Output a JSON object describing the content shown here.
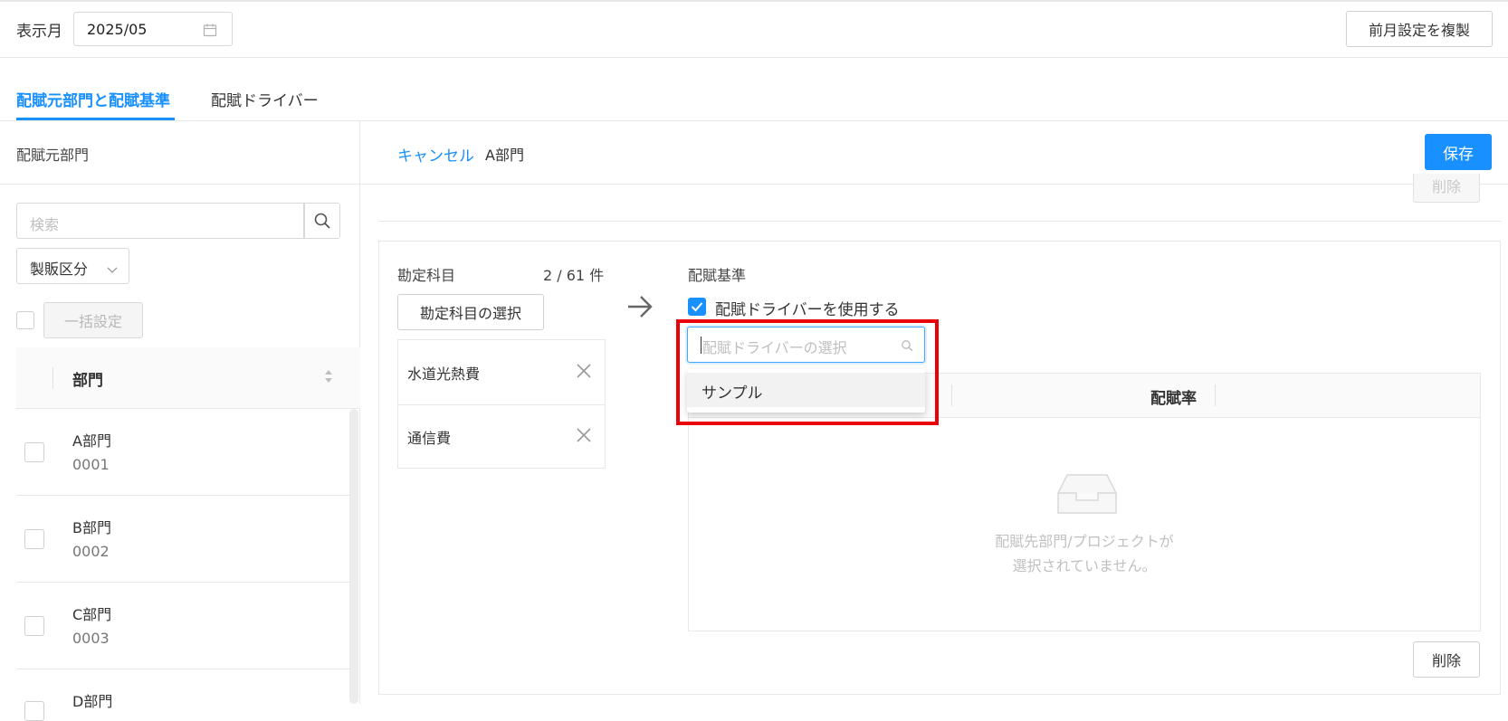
{
  "header": {
    "month_label": "表示月",
    "month_value": "2025/05",
    "copy_button": "前月設定を複製"
  },
  "tabs": [
    {
      "label": "配賦元部門と配賦基準",
      "active": true
    },
    {
      "label": "配賦ドライバー",
      "active": false
    }
  ],
  "left_panel": {
    "title": "配賦元部門",
    "search_placeholder": "検索",
    "filter_label": "製販区分",
    "bulk_button": "一括設定",
    "column_header": "部門",
    "rows": [
      {
        "name": "A部門",
        "code": "0001"
      },
      {
        "name": "B部門",
        "code": "0002"
      },
      {
        "name": "C部門",
        "code": "0003"
      },
      {
        "name": "D部門",
        "code": ""
      }
    ]
  },
  "editor": {
    "cancel_link": "キャンセル",
    "department": "A部門",
    "save_button": "保存",
    "ghost_delete": "削除",
    "accounts_label": "勘定科目",
    "accounts_count": "2 / 61 件",
    "accounts_select_button": "勘定科目の選択",
    "accounts": [
      "水道光熱費",
      "通信費"
    ],
    "basis_label": "配賦基準",
    "use_driver_label": "配賦ドライバーを使用する",
    "use_driver_checked": true,
    "driver_placeholder": "配賦ドライバーの選択",
    "dropdown_options": [
      "サンプル"
    ],
    "rate_header": "配賦率",
    "empty_line1": "配賦先部門/プロジェクトが",
    "empty_line2": "選択されていません。",
    "delete_button": "削除"
  },
  "colors": {
    "accent": "#1890ff",
    "highlight": "#e8000a"
  }
}
